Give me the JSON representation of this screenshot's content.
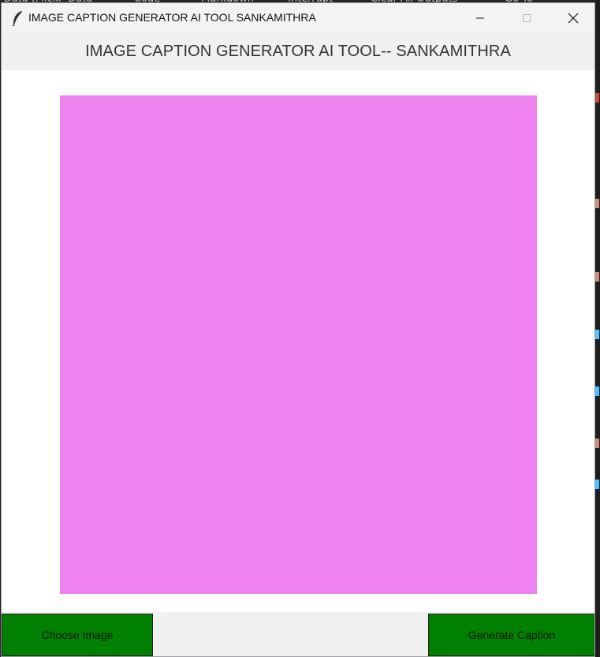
{
  "window": {
    "title": "IMAGE CAPTION GENERATOR AI TOOL SANKAMITHRA",
    "icon": "feather-icon",
    "controls": {
      "minimize": "minimize-icon",
      "maximize": "maximize-icon",
      "close": "close-icon"
    }
  },
  "header": {
    "title": "IMAGE CAPTION GENERATOR AI TOOL-- SANKAMITHRA"
  },
  "image_panel": {
    "color": "#ee82ee"
  },
  "buttons": {
    "choose_label": "Choose Image",
    "generate_label": "Generate Caption",
    "color": "#008000"
  },
  "caption": {
    "text": ""
  }
}
